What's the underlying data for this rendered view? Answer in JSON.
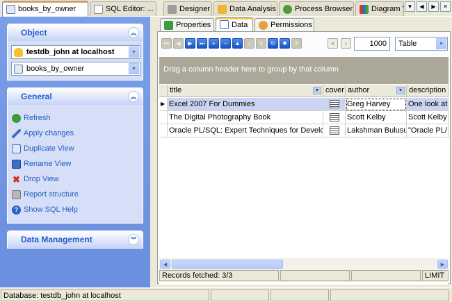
{
  "document_tabs": [
    {
      "label": "books_by_owner",
      "active": true
    },
    {
      "label": "SQL Editor: ...",
      "active": false
    },
    {
      "label": "Designer",
      "active": false
    },
    {
      "label": "Data Analysis",
      "active": false
    },
    {
      "label": "Process Browser",
      "active": false
    },
    {
      "label": "Diagram V",
      "active": false
    }
  ],
  "sidebar": {
    "object": {
      "title": "Object",
      "database": "testdb_john at localhost",
      "view": "books_by_owner"
    },
    "general": {
      "title": "General",
      "actions": [
        {
          "label": "Refresh",
          "icon": "refresh-icon"
        },
        {
          "label": "Apply changes",
          "icon": "apply-icon"
        },
        {
          "label": "Duplicate View",
          "icon": "duplicate-icon"
        },
        {
          "label": "Rename View",
          "icon": "rename-icon"
        },
        {
          "label": "Drop View",
          "icon": "drop-icon"
        },
        {
          "label": "Report structure",
          "icon": "report-icon"
        },
        {
          "label": "Show SQL Help",
          "icon": "help-icon"
        }
      ]
    },
    "data_management": {
      "title": "Data Management"
    }
  },
  "sub_tabs": [
    {
      "label": "Properties",
      "active": false
    },
    {
      "label": "Data",
      "active": true
    },
    {
      "label": "Permissions",
      "active": false
    }
  ],
  "navigator": {
    "record_limit": "1000",
    "view_mode": "Table"
  },
  "grid": {
    "group_hint": "Drag a column header here to group by that column",
    "columns": [
      "title",
      "cover",
      "author",
      "description"
    ],
    "rows": [
      {
        "title": "Excel 2007 For Dummies",
        "author": "Greg Harvey",
        "description": "One look at"
      },
      {
        "title": "The Digital Photography Book",
        "author": "Scott Kelby",
        "description": "Scott Kelby"
      },
      {
        "title": "Oracle PL/SQL: Expert Techniques for Develop",
        "author": "Lakshman Bulusu",
        "description": "\"Oracle PL/"
      }
    ],
    "records_fetched": "Records fetched: 3/3",
    "limit_label": "LIMIT"
  },
  "statusbar": {
    "database": "Database: testdb_john at localhost"
  }
}
